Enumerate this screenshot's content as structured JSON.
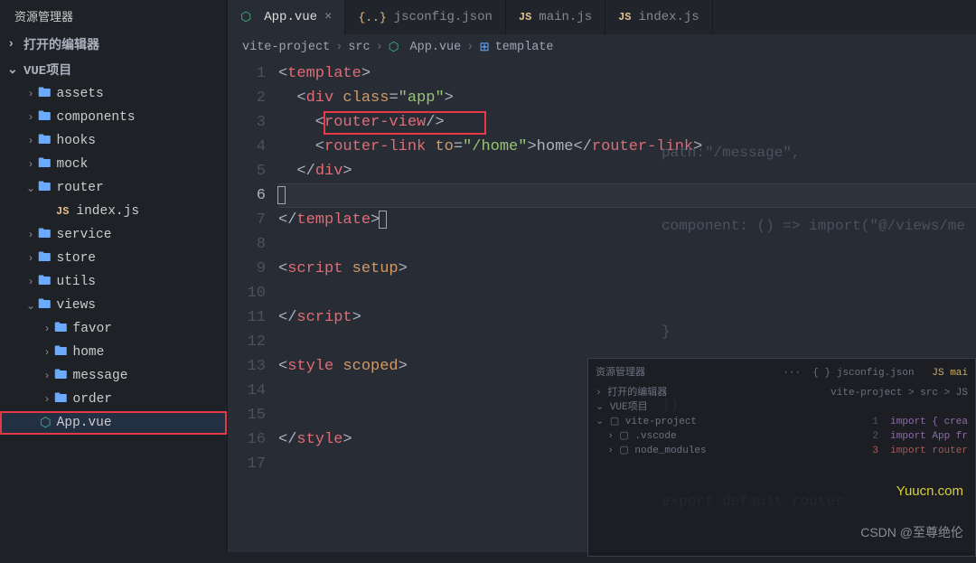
{
  "sidebar": {
    "title": "资源管理器",
    "openEditors": "打开的编辑器",
    "project": "VUE项目",
    "tree": [
      {
        "depth": 1,
        "chev": ">",
        "icon": "folder",
        "label": "assets"
      },
      {
        "depth": 1,
        "chev": ">",
        "icon": "folder",
        "label": "components"
      },
      {
        "depth": 1,
        "chev": ">",
        "icon": "folder",
        "label": "hooks"
      },
      {
        "depth": 1,
        "chev": ">",
        "icon": "folder",
        "label": "mock"
      },
      {
        "depth": 1,
        "chev": "v",
        "icon": "folder",
        "label": "router"
      },
      {
        "depth": 2,
        "chev": "",
        "icon": "js",
        "label": "index.js"
      },
      {
        "depth": 1,
        "chev": ">",
        "icon": "folder",
        "label": "service"
      },
      {
        "depth": 1,
        "chev": ">",
        "icon": "folder",
        "label": "store"
      },
      {
        "depth": 1,
        "chev": ">",
        "icon": "folder",
        "label": "utils"
      },
      {
        "depth": 1,
        "chev": "v",
        "icon": "folder",
        "label": "views"
      },
      {
        "depth": 2,
        "chev": ">",
        "icon": "folder",
        "label": "favor"
      },
      {
        "depth": 2,
        "chev": ">",
        "icon": "folder",
        "label": "home"
      },
      {
        "depth": 2,
        "chev": ">",
        "icon": "folder",
        "label": "message"
      },
      {
        "depth": 2,
        "chev": ">",
        "icon": "folder",
        "label": "order"
      },
      {
        "depth": 1,
        "chev": "",
        "icon": "vue",
        "label": "App.vue",
        "selected": true,
        "boxed": true
      }
    ]
  },
  "tabs": [
    {
      "icon": "vue",
      "label": "App.vue",
      "active": true,
      "close": "×"
    },
    {
      "icon": "curly",
      "label": "jsconfig.json"
    },
    {
      "icon": "js",
      "label": "main.js"
    },
    {
      "icon": "js",
      "label": "index.js"
    }
  ],
  "breadcrumb": {
    "parts": [
      "vite-project",
      "src",
      "App.vue",
      "template"
    ]
  },
  "code": {
    "lines": 17,
    "activeLine": 6
  },
  "ghost": {
    "l1": "path:\"/message\",",
    "l2": "component: () => import(\"@/views/me",
    "l3": "}",
    "l4": "})",
    "l5": "export default router"
  },
  "tokens": {
    "template": "template",
    "div": "div",
    "class": "class",
    "app": "\"app\"",
    "routerview": "router-view",
    "routerlink": "router-link",
    "to": "to",
    "home": "\"/home\"",
    "hometext": "home",
    "script": "script",
    "setup": "setup",
    "style": "style",
    "scoped": "scoped"
  },
  "miniPreview": {
    "title": "资源管理器",
    "tab1": "{ } jsconfig.json",
    "tab2": "JS  mai",
    "bc": "vite-project > src > JS",
    "openEditors": "打开的编辑器",
    "project": "VUE项目",
    "rows": [
      "vite-project",
      ".vscode",
      "node_modules"
    ],
    "codeLines": [
      "import { crea",
      "import App fr",
      "import router"
    ]
  },
  "watermark": "Yuucn.com",
  "csdn": "CSDN @至尊绝伦"
}
